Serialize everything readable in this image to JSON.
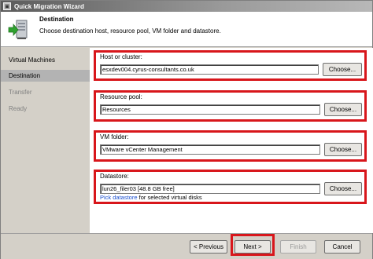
{
  "window": {
    "title": "Quick Migration Wizard"
  },
  "header": {
    "title": "Destination",
    "subtitle": "Choose destination host, resource pool, VM folder and datastore."
  },
  "sidebar": {
    "items": [
      {
        "label": "Virtual Machines",
        "state": "normal"
      },
      {
        "label": "Destination",
        "state": "active"
      },
      {
        "label": "Transfer",
        "state": "disabled"
      },
      {
        "label": "Ready",
        "state": "disabled"
      }
    ]
  },
  "form": {
    "host": {
      "label": "Host or cluster:",
      "value": "esxdev004.cyrus-consultants.co.uk",
      "button": "Choose..."
    },
    "pool": {
      "label": "Resource pool:",
      "value": "Resources",
      "button": "Choose..."
    },
    "folder": {
      "label": "VM folder:",
      "value": "VMware vCenter Management",
      "button": "Choose..."
    },
    "datastore": {
      "label": "Datastore:",
      "value": "lun26_filer03 [48.8 GB free]",
      "button": "Choose...",
      "link": "Pick datastore",
      "note": " for selected virtual disks"
    }
  },
  "footer": {
    "previous": "< Previous",
    "next": "Next >",
    "finish": "Finish",
    "cancel": "Cancel"
  },
  "colors": {
    "highlight": "#d8161b",
    "link": "#1a4fcf",
    "active_nav": "#b3b3b3"
  }
}
